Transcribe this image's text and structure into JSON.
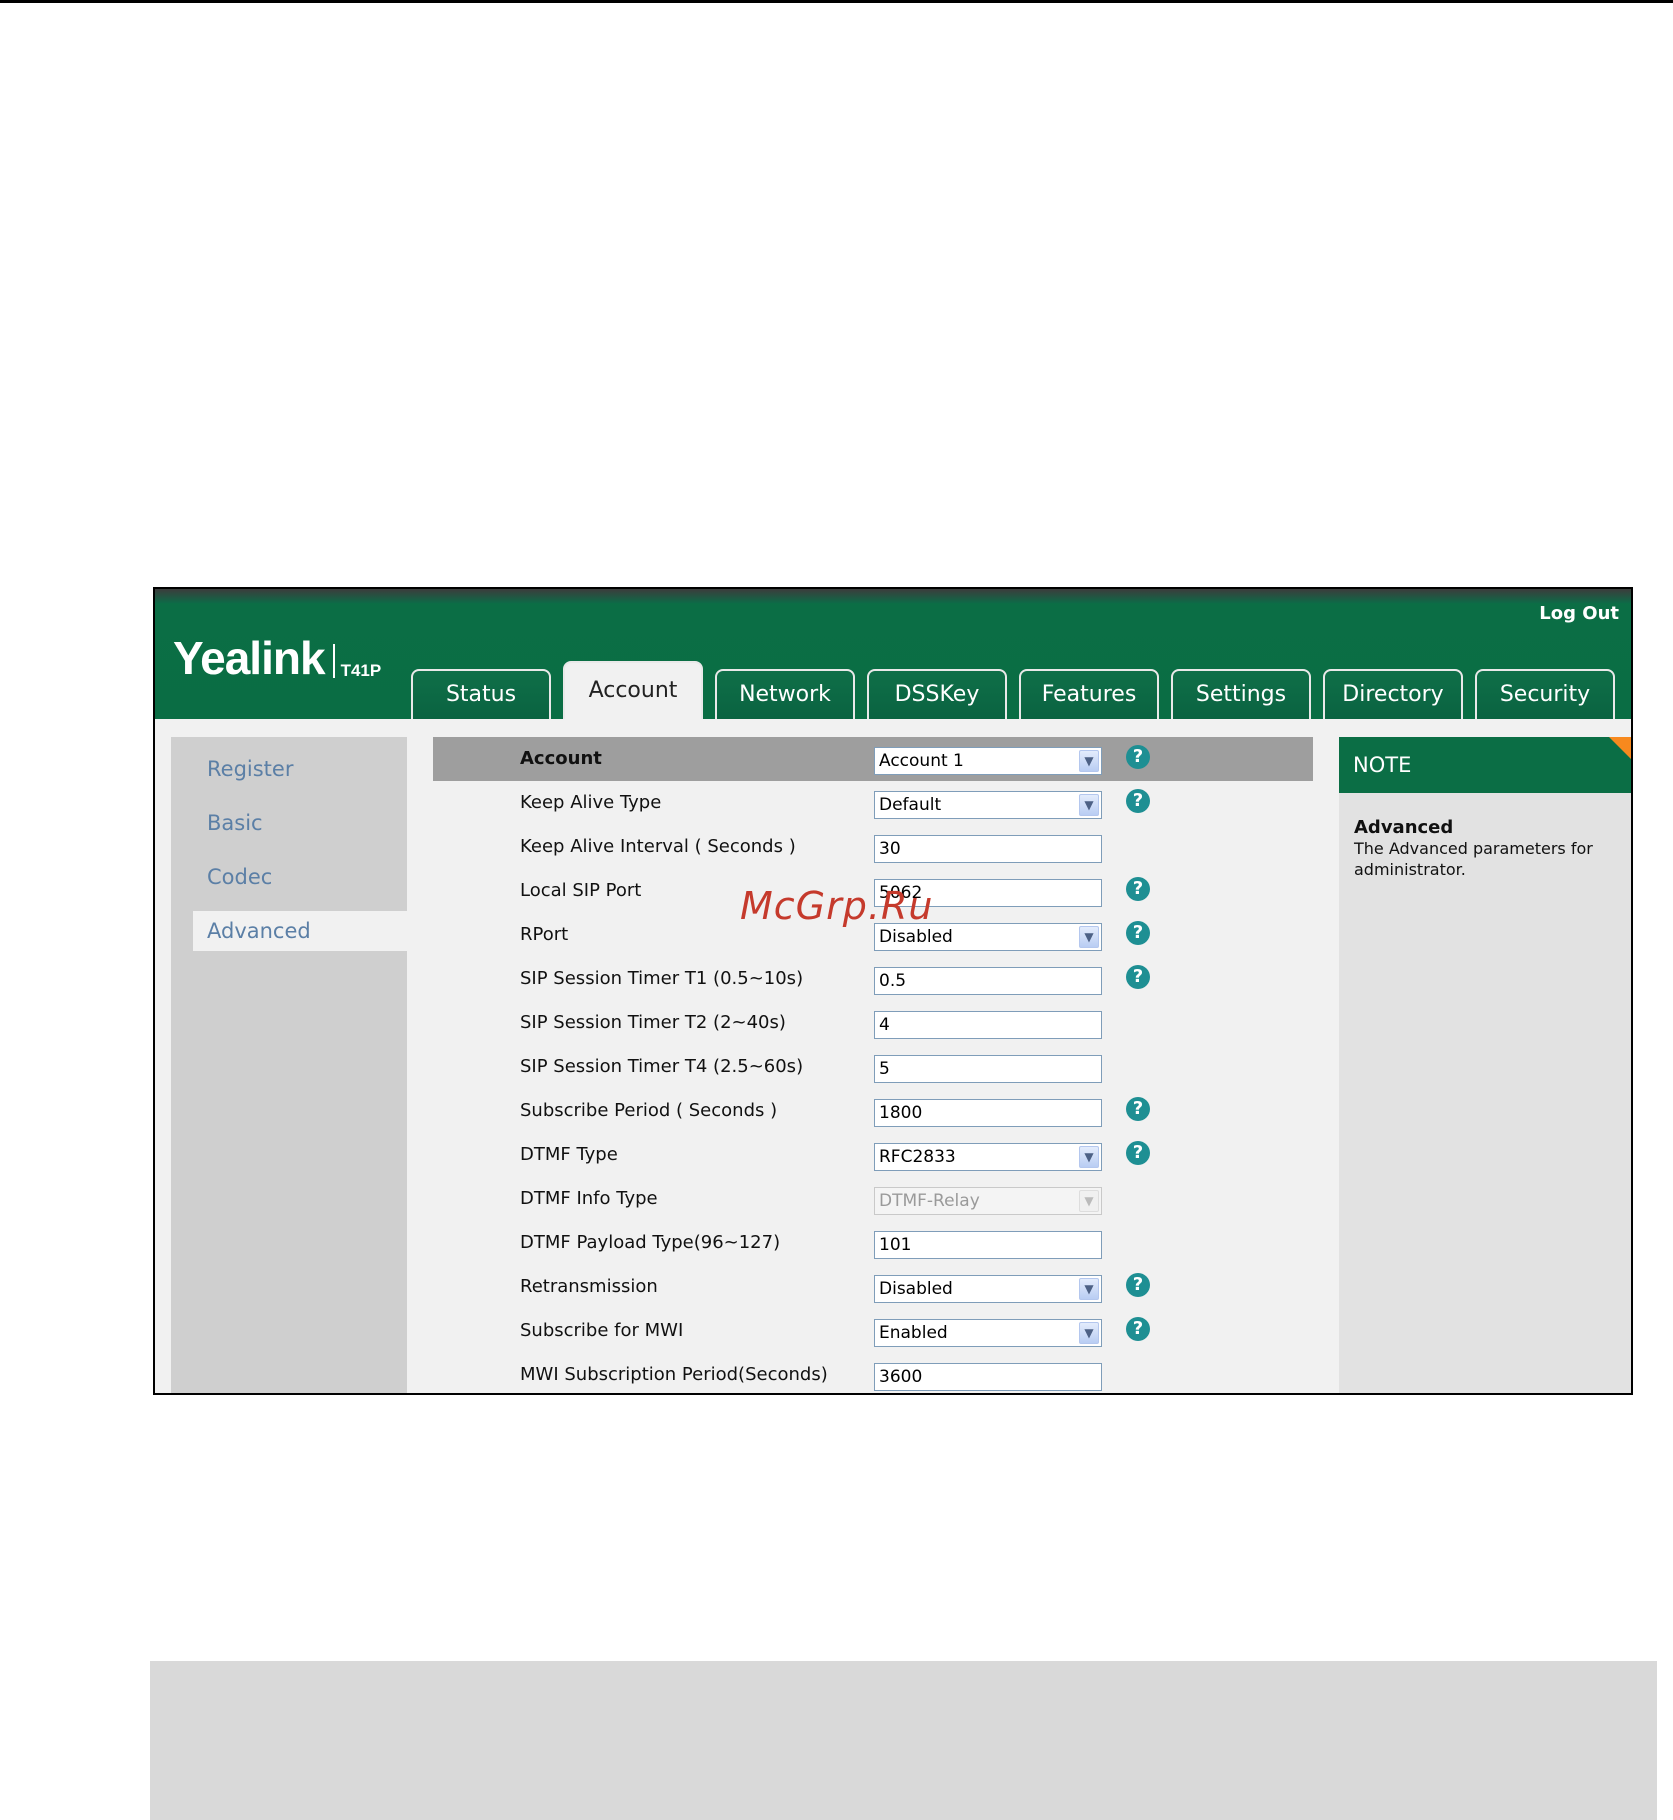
{
  "header": {
    "logo_brand": "Yealink",
    "logo_model": "T41P",
    "logout": "Log Out"
  },
  "tabs": [
    {
      "label": "Status",
      "active": false
    },
    {
      "label": "Account",
      "active": true
    },
    {
      "label": "Network",
      "active": false
    },
    {
      "label": "DSSKey",
      "active": false
    },
    {
      "label": "Features",
      "active": false
    },
    {
      "label": "Settings",
      "active": false
    },
    {
      "label": "Directory",
      "active": false
    },
    {
      "label": "Security",
      "active": false
    }
  ],
  "sidebar": {
    "items": [
      {
        "label": "Register",
        "active": false
      },
      {
        "label": "Basic",
        "active": false
      },
      {
        "label": "Codec",
        "active": false
      },
      {
        "label": "Advanced",
        "active": true
      }
    ]
  },
  "form": {
    "rows": [
      {
        "label": "Account",
        "type": "select",
        "value": "Account 1",
        "help": true
      },
      {
        "label": "Keep Alive Type",
        "type": "select",
        "value": "Default",
        "help": true
      },
      {
        "label": "Keep Alive Interval ( Seconds )",
        "type": "input",
        "value": "30",
        "help": false
      },
      {
        "label": "Local SIP Port",
        "type": "input",
        "value": "5062",
        "help": true
      },
      {
        "label": "RPort",
        "type": "select",
        "value": "Disabled",
        "help": true
      },
      {
        "label": "SIP Session Timer T1 (0.5~10s)",
        "type": "input",
        "value": "0.5",
        "help": true
      },
      {
        "label": "SIP Session Timer T2 (2~40s)",
        "type": "input",
        "value": "4",
        "help": false
      },
      {
        "label": "SIP Session Timer T4 (2.5~60s)",
        "type": "input",
        "value": "5",
        "help": false
      },
      {
        "label": "Subscribe Period ( Seconds )",
        "type": "input",
        "value": "1800",
        "help": true
      },
      {
        "label": "DTMF Type",
        "type": "select",
        "value": "RFC2833",
        "help": true
      },
      {
        "label": "DTMF Info Type",
        "type": "select",
        "value": "DTMF-Relay",
        "help": false,
        "disabled": true
      },
      {
        "label": "DTMF Payload Type(96~127)",
        "type": "input",
        "value": "101",
        "help": false
      },
      {
        "label": "Retransmission",
        "type": "select",
        "value": "Disabled",
        "help": true
      },
      {
        "label": "Subscribe for MWI",
        "type": "select",
        "value": "Enabled",
        "help": true
      },
      {
        "label": "MWI Subscription Period(Seconds)",
        "type": "input",
        "value": "3600",
        "help": false
      }
    ],
    "help_glyph": "?",
    "arrow_glyph": "▼"
  },
  "note": {
    "header": "NOTE",
    "title": "Advanced",
    "text": "The Advanced parameters for administrator."
  },
  "watermark": "McGrp.Ru",
  "colors": {
    "brand_green": "#0b6e45",
    "note_accent": "#f7891e",
    "link_blue": "#5b7fa6",
    "help_teal": "#1e8f93"
  }
}
